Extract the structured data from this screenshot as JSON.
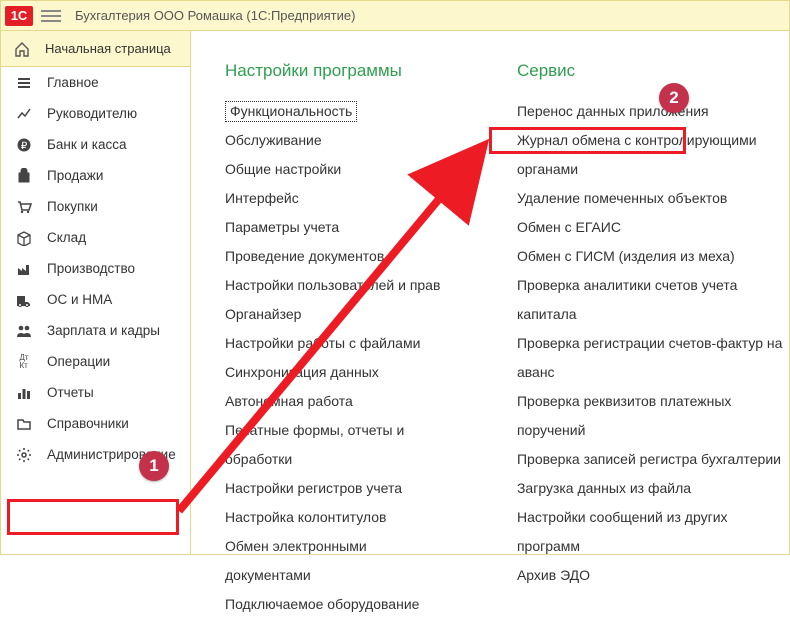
{
  "titlebar": {
    "logo_text": "1С",
    "title": "Бухгалтерия ООО Ромашка  (1С:Предприятие)"
  },
  "start_page": {
    "label": "Начальная страница"
  },
  "sidebar": {
    "items": [
      {
        "label": "Главное",
        "icon": "bars-icon"
      },
      {
        "label": "Руководителю",
        "icon": "chart-line-icon"
      },
      {
        "label": "Банк и касса",
        "icon": "ruble-icon"
      },
      {
        "label": "Продажи",
        "icon": "bag-icon"
      },
      {
        "label": "Покупки",
        "icon": "cart-icon"
      },
      {
        "label": "Склад",
        "icon": "box-icon"
      },
      {
        "label": "Производство",
        "icon": "factory-icon"
      },
      {
        "label": "ОС и НМА",
        "icon": "truck-icon"
      },
      {
        "label": "Зарплата и кадры",
        "icon": "people-icon"
      },
      {
        "label": "Операции",
        "icon": "dtkt-icon"
      },
      {
        "label": "Отчеты",
        "icon": "barchart-icon"
      },
      {
        "label": "Справочники",
        "icon": "folder-icon"
      },
      {
        "label": "Администрирование",
        "icon": "gear-icon"
      }
    ]
  },
  "main": {
    "col1": {
      "title": "Настройки программы",
      "items": [
        "Функциональность",
        "Обслуживание",
        "Общие настройки",
        "Интерфейс",
        "Параметры учета",
        "Проведение документов",
        "Настройки пользователей и прав",
        "Органайзер",
        "Настройки работы с файлами",
        "Синхронизация данных",
        "Автономная работа",
        "Печатные формы, отчеты и обработки",
        "Настройки регистров учета",
        "Настройка колонтитулов",
        "Обмен электронными документами",
        "Подключаемое оборудование"
      ]
    },
    "col2": {
      "title": "Сервис",
      "items": [
        "Перенос данных приложения",
        "Журнал обмена с контролирующими органами",
        "Удаление помеченных объектов",
        "Обмен с ЕГАИС",
        "Обмен с ГИСМ (изделия из меха)",
        "Проверка аналитики счетов учета капитала",
        "Проверка регистрации счетов-фактур на аванс",
        "Проверка реквизитов платежных поручений",
        "Проверка записей регистра бухгалтерии",
        "Загрузка данных из файла",
        "Настройки сообщений из других программ",
        "Архив ЭДО"
      ]
    }
  },
  "annotations": {
    "badge1": "1",
    "badge2": "2"
  },
  "icons": {
    "home": "⌂",
    "bars": "≡",
    "chart": "✓",
    "ruble": "₽",
    "bag": "▣",
    "cart": "▤",
    "box": "▥",
    "factory": "▦",
    "truck": "▧",
    "people": "▨",
    "dtkt": "Дт",
    "barchart": "▩",
    "folder": "▪",
    "gear": "⚙"
  }
}
